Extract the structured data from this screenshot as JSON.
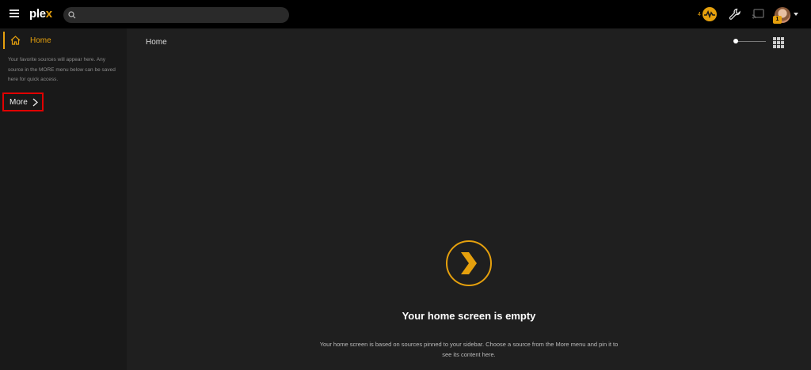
{
  "app": {
    "logo_text": "ple",
    "logo_accent": "x"
  },
  "search": {
    "placeholder": ""
  },
  "header": {
    "activity_count": "4",
    "avatar_badge": "1"
  },
  "sidebar": {
    "home_label": "Home",
    "note": "Your favorite sources will appear here. Any source in the MORE menu below can be saved here for quick access.",
    "more_label": "More"
  },
  "main": {
    "title": "Home",
    "empty_title": "Your home screen is empty",
    "empty_desc": "Your home screen is based on sources pinned to your sidebar. Choose a source from the More menu and pin it to see its content here."
  },
  "colors": {
    "accent": "#e5a00d",
    "topbar": "#000000",
    "sidebar": "#191919",
    "main": "#1f1f1f",
    "highlight": "#e00000"
  },
  "icons": [
    "menu-icon",
    "search-icon",
    "activity-icon",
    "wrench-icon",
    "cast-icon",
    "home-icon",
    "chevron-right-icon",
    "grid-icon",
    "plex-chevron-icon"
  ]
}
